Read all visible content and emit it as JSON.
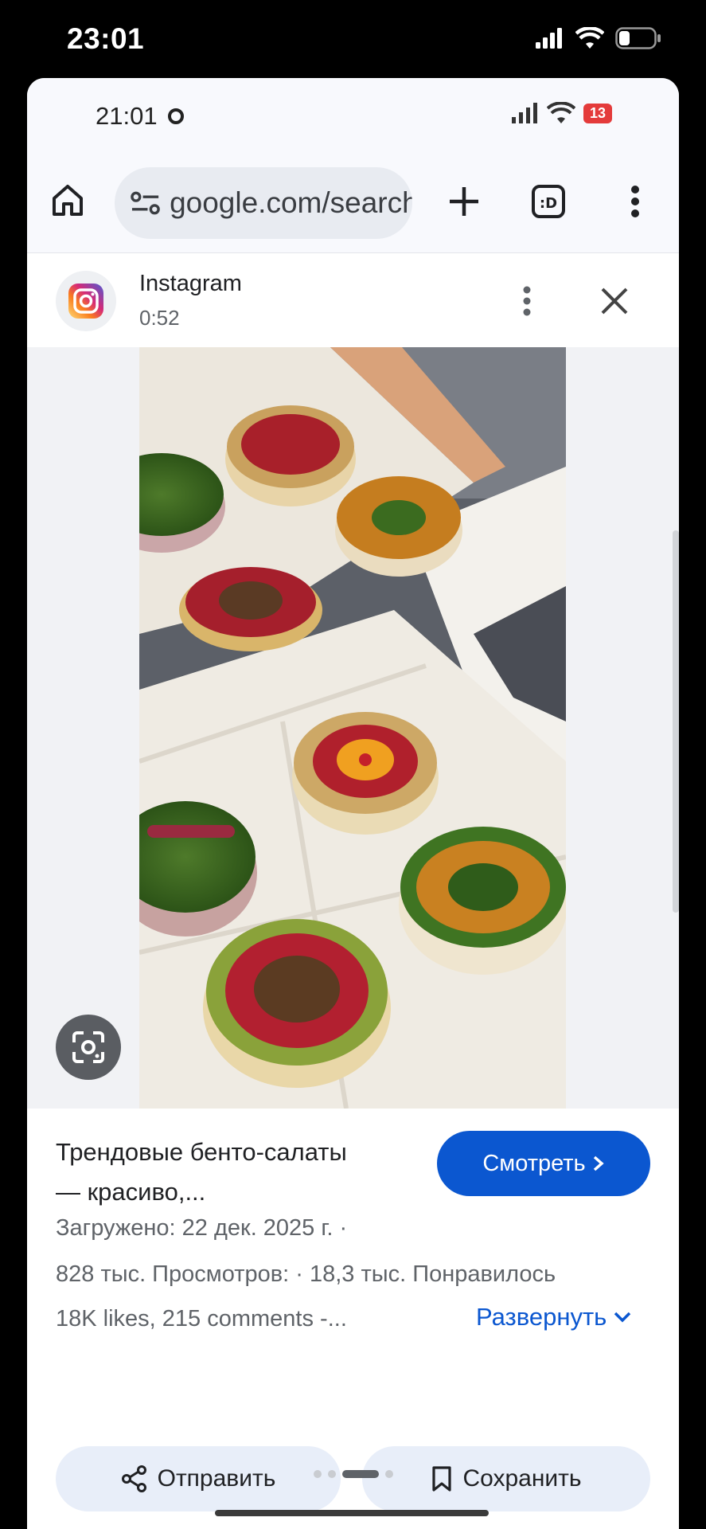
{
  "ios_status": {
    "time": "23:01"
  },
  "android_status": {
    "time": "21:01",
    "battery": "13"
  },
  "chrome": {
    "url": "google.com/search"
  },
  "panel": {
    "source": "Instagram",
    "duration": "0:52"
  },
  "info": {
    "title": "Трендовые бенто-салаты — красиво,...",
    "watch_label": "Смотреть",
    "uploaded": "Загружено: 22 дек. 2025 г.  ·",
    "stats": "828 тыс. Просмотров:  ·  18,3 тыс. Понравилось",
    "snippet": "18K likes, 215 comments -...",
    "expand_label": "Развернуть",
    "share_label": "Отправить",
    "save_label": "Сохранить"
  },
  "colors": {
    "accent": "#0b57d0",
    "pill": "#e8eef9"
  }
}
